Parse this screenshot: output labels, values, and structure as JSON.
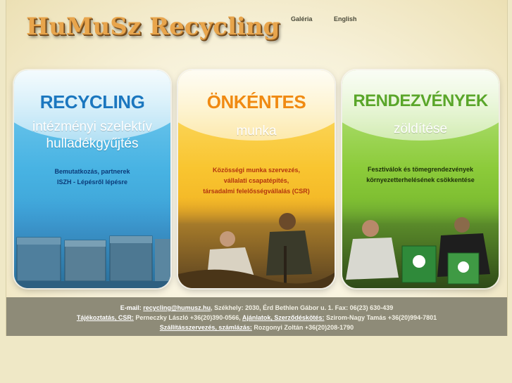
{
  "header": {
    "logo_text": "HuMuSz Recycling",
    "nav": [
      {
        "label": "Galéria"
      },
      {
        "label": "English"
      }
    ]
  },
  "cards": [
    {
      "title": "RECYCLING",
      "sub_line1": "intézményi szelektív",
      "sub_line2": "hulladékgyűjtés",
      "desc": [
        "Bemutatkozás, partnerek",
        "ISZH - Lépésről lépésre"
      ],
      "photo": "recycling-containers-photo"
    },
    {
      "title": "ÖNKÉNTES",
      "sub_line1": "munka",
      "sub_line2": "",
      "desc": [
        "Közösségi  munka szervezés,",
        "vállalati csapatépítés,",
        "társadalmi felelősségvállalás (CSR)"
      ],
      "photo": "volunteers-planting-photo"
    },
    {
      "title": "RENDEZVÉNYEK",
      "sub_line1": "zöldítése",
      "sub_line2": "",
      "desc": [
        "Fesztiválok és tömegrendezvények",
        "környezetterhelésének csökkentése"
      ],
      "photo": "festival-bins-photo"
    }
  ],
  "footer": {
    "line1": {
      "prefix": "E-mail: ",
      "email": "recycling@humusz.hu",
      "rest": ", Székhely: 2030, Érd Bethlen Gábor u. 1. Fax: 06(23) 630-439"
    },
    "line2": {
      "link1": "Tájékoztatás, CSR:",
      "text1": " Perneczky László +36(20)390-0566, ",
      "link2": "Ajánlatok, Szerződéskötés:",
      "text2": " Szirom-Nagy Tamás +36(20)994-7801"
    },
    "line3": {
      "link": "Szállításszervezés, számlázás:",
      "text": " Rozgonyi Zoltán +36(20)208-1790"
    }
  },
  "colors": {
    "recycling_blue": "#1b77bf",
    "volunteer_orange": "#f08a12",
    "events_green": "#5aa62a",
    "footer_bg": "#8e8b78"
  }
}
